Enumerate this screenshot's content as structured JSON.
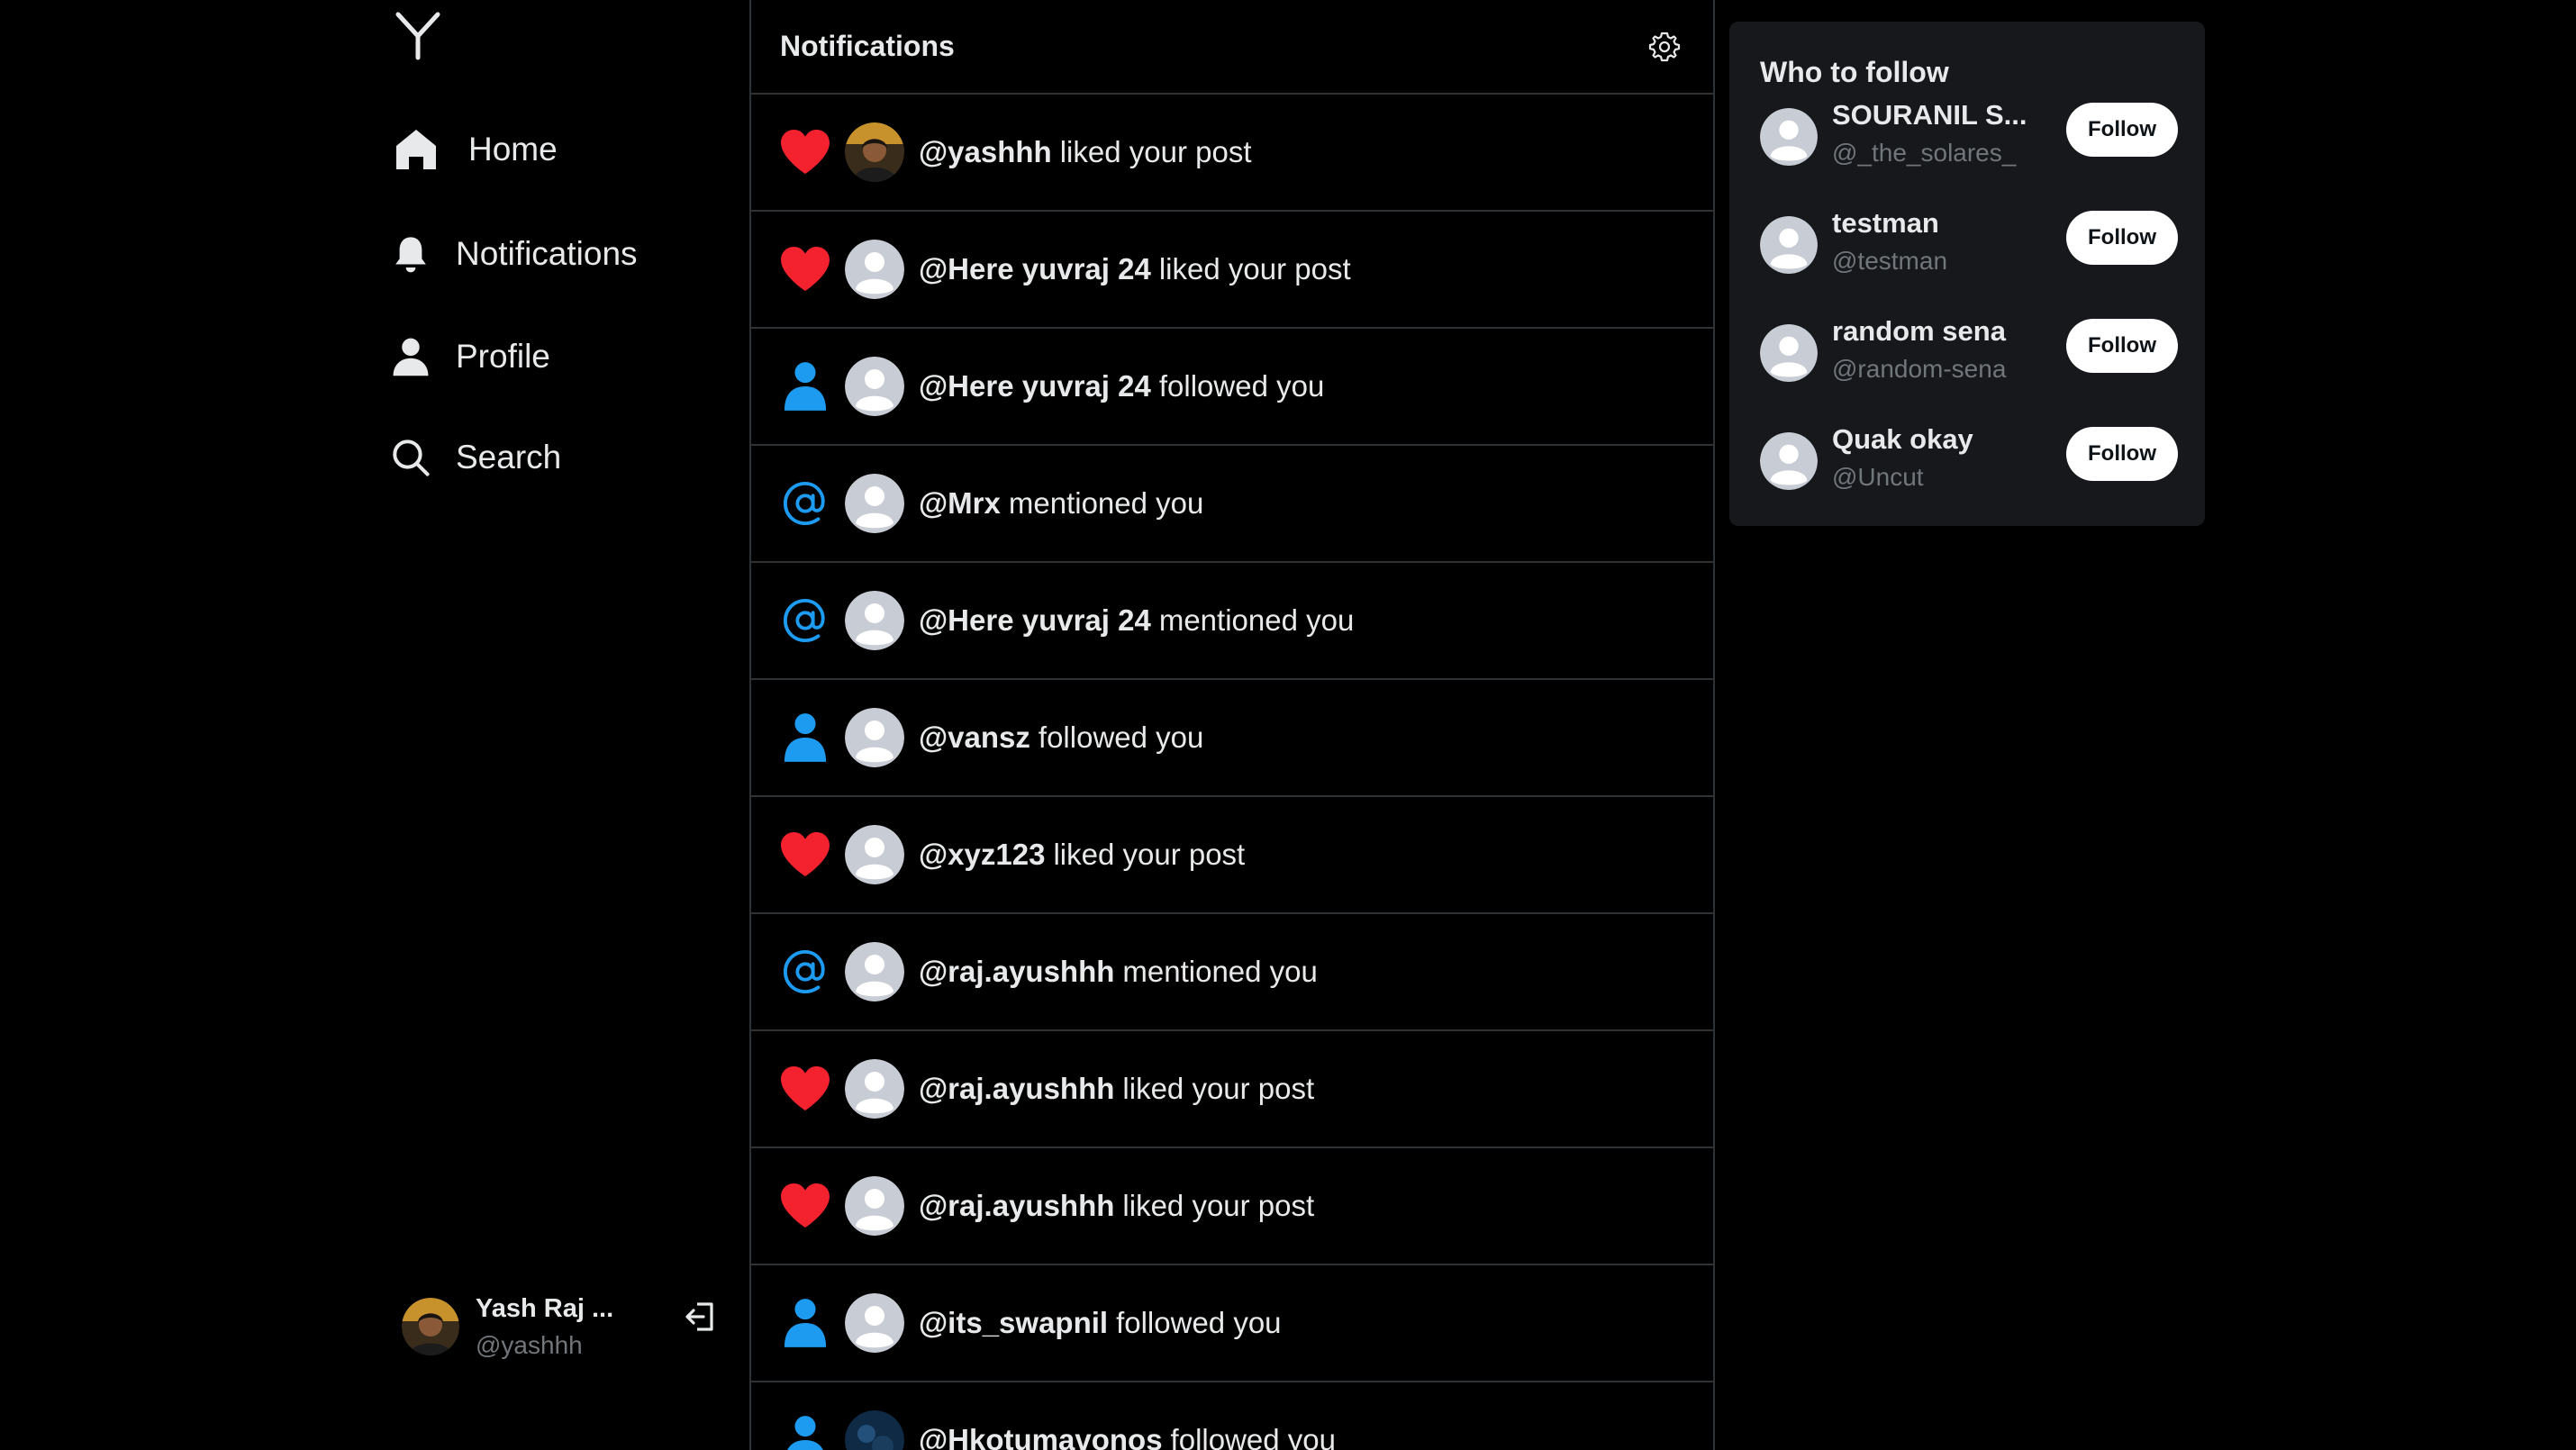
{
  "sidebar": {
    "logo": "Y",
    "nav": [
      {
        "label": "Home",
        "icon": "home-icon"
      },
      {
        "label": "Notifications",
        "icon": "bell-icon"
      },
      {
        "label": "Profile",
        "icon": "user-icon"
      },
      {
        "label": "Search",
        "icon": "search-icon"
      }
    ],
    "account": {
      "name": "Yash Raj ...",
      "handle": "@yashhh"
    }
  },
  "main": {
    "title": "Notifications",
    "notifications": [
      {
        "type": "like",
        "user": "@yashhh",
        "action": "liked your post",
        "avatar": "photo"
      },
      {
        "type": "like",
        "user": "@Here yuvraj 24",
        "action": "liked your post",
        "avatar": "default"
      },
      {
        "type": "follow",
        "user": "@Here yuvraj 24",
        "action": "followed you",
        "avatar": "default"
      },
      {
        "type": "mention",
        "user": "@Mrx",
        "action": "mentioned you",
        "avatar": "default"
      },
      {
        "type": "mention",
        "user": "@Here yuvraj 24",
        "action": "mentioned you",
        "avatar": "default"
      },
      {
        "type": "follow",
        "user": "@vansz",
        "action": "followed you",
        "avatar": "default"
      },
      {
        "type": "like",
        "user": "@xyz123",
        "action": "liked your post",
        "avatar": "default"
      },
      {
        "type": "mention",
        "user": "@raj.ayushhh",
        "action": "mentioned you",
        "avatar": "default"
      },
      {
        "type": "like",
        "user": "@raj.ayushhh",
        "action": "liked your post",
        "avatar": "default"
      },
      {
        "type": "like",
        "user": "@raj.ayushhh",
        "action": "liked your post",
        "avatar": "default"
      },
      {
        "type": "follow",
        "user": "@its_swapnil",
        "action": "followed you",
        "avatar": "default"
      },
      {
        "type": "follow",
        "user": "@Hkotumavonos",
        "action": "followed you",
        "avatar": "dark"
      }
    ]
  },
  "who_to_follow": {
    "title": "Who to follow",
    "button_label": "Follow",
    "users": [
      {
        "name": "SOURANIL S...",
        "handle": "@_the_solares_"
      },
      {
        "name": "testman",
        "handle": "@testman"
      },
      {
        "name": "random sena",
        "handle": "@random-sena"
      },
      {
        "name": "Quak okay",
        "handle": "@Uncut"
      }
    ]
  },
  "colors": {
    "like": "#f4212e",
    "follow": "#1d9bf0",
    "mention": "#1d9bf0",
    "muted_text": "#71767b",
    "border": "#2f3336",
    "card_bg": "#16181c"
  }
}
